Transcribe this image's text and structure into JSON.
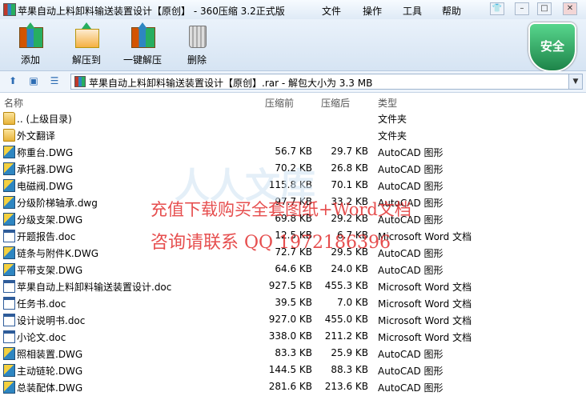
{
  "window": {
    "title": "苹果自动上料卸料输送装置设计【原创】 - 360压缩 3.2正式版",
    "menu": [
      "文件",
      "操作",
      "工具",
      "帮助"
    ]
  },
  "toolbar": {
    "buttons": [
      {
        "label": "添加",
        "icon": "add-archive-icon"
      },
      {
        "label": "解压到",
        "icon": "extract-to-icon"
      },
      {
        "label": "一键解压",
        "icon": "one-click-extract-icon"
      },
      {
        "label": "删除",
        "icon": "trash-icon"
      }
    ],
    "security_badge": "安全"
  },
  "address": {
    "text": "苹果自动上料卸料输送装置设计【原创】.rar - 解包大小为 3.3 MB"
  },
  "columns": {
    "name": "名称",
    "original": "压缩前",
    "compressed": "压缩后",
    "type": "类型"
  },
  "files": [
    {
      "name": ".. (上级目录)",
      "original": "",
      "compressed": "",
      "type": "文件夹",
      "icon": "folder"
    },
    {
      "name": "外文翻译",
      "original": "",
      "compressed": "",
      "type": "文件夹",
      "icon": "folder"
    },
    {
      "name": "称重台.DWG",
      "original": "56.7 KB",
      "compressed": "29.7 KB",
      "type": "AutoCAD 图形",
      "icon": "dwg"
    },
    {
      "name": "承托器.DWG",
      "original": "70.2 KB",
      "compressed": "26.8 KB",
      "type": "AutoCAD 图形",
      "icon": "dwg"
    },
    {
      "name": "电磁阀.DWG",
      "original": "115.8 KB",
      "compressed": "70.1 KB",
      "type": "AutoCAD 图形",
      "icon": "dwg"
    },
    {
      "name": "分级阶梯轴承.dwg",
      "original": "97.7 KB",
      "compressed": "33.2 KB",
      "type": "AutoCAD 图形",
      "icon": "dwg"
    },
    {
      "name": "分级支架.DWG",
      "original": "69.8 KB",
      "compressed": "29.2 KB",
      "type": "AutoCAD 图形",
      "icon": "dwg"
    },
    {
      "name": "开题报告.doc",
      "original": "12.5 KB",
      "compressed": "6.7 KB",
      "type": "Microsoft Word 文档",
      "icon": "doc"
    },
    {
      "name": "链条与附件K.DWG",
      "original": "72.7 KB",
      "compressed": "29.5 KB",
      "type": "AutoCAD 图形",
      "icon": "dwg"
    },
    {
      "name": "平带支架.DWG",
      "original": "64.6 KB",
      "compressed": "24.0 KB",
      "type": "AutoCAD 图形",
      "icon": "dwg"
    },
    {
      "name": "苹果自动上料卸料输送装置设计.doc",
      "original": "927.5 KB",
      "compressed": "455.3 KB",
      "type": "Microsoft Word 文档",
      "icon": "doc"
    },
    {
      "name": "任务书.doc",
      "original": "39.5 KB",
      "compressed": "7.0 KB",
      "type": "Microsoft Word 文档",
      "icon": "doc"
    },
    {
      "name": "设计说明书.doc",
      "original": "927.0 KB",
      "compressed": "455.0 KB",
      "type": "Microsoft Word 文档",
      "icon": "doc"
    },
    {
      "name": "小论文.doc",
      "original": "338.0 KB",
      "compressed": "211.2 KB",
      "type": "Microsoft Word 文档",
      "icon": "doc"
    },
    {
      "name": "照相装置.DWG",
      "original": "83.3 KB",
      "compressed": "25.9 KB",
      "type": "AutoCAD 图形",
      "icon": "dwg"
    },
    {
      "name": "主动链轮.DWG",
      "original": "144.5 KB",
      "compressed": "88.3 KB",
      "type": "AutoCAD 图形",
      "icon": "dwg"
    },
    {
      "name": "总装配体.DWG",
      "original": "281.6 KB",
      "compressed": "213.6 KB",
      "type": "AutoCAD 图形",
      "icon": "dwg"
    }
  ],
  "watermark": {
    "line1": "充值下载购买全套图纸+Word文档",
    "line2": "咨询请联系 QQ 1972186396",
    "logo": "人人文库"
  }
}
